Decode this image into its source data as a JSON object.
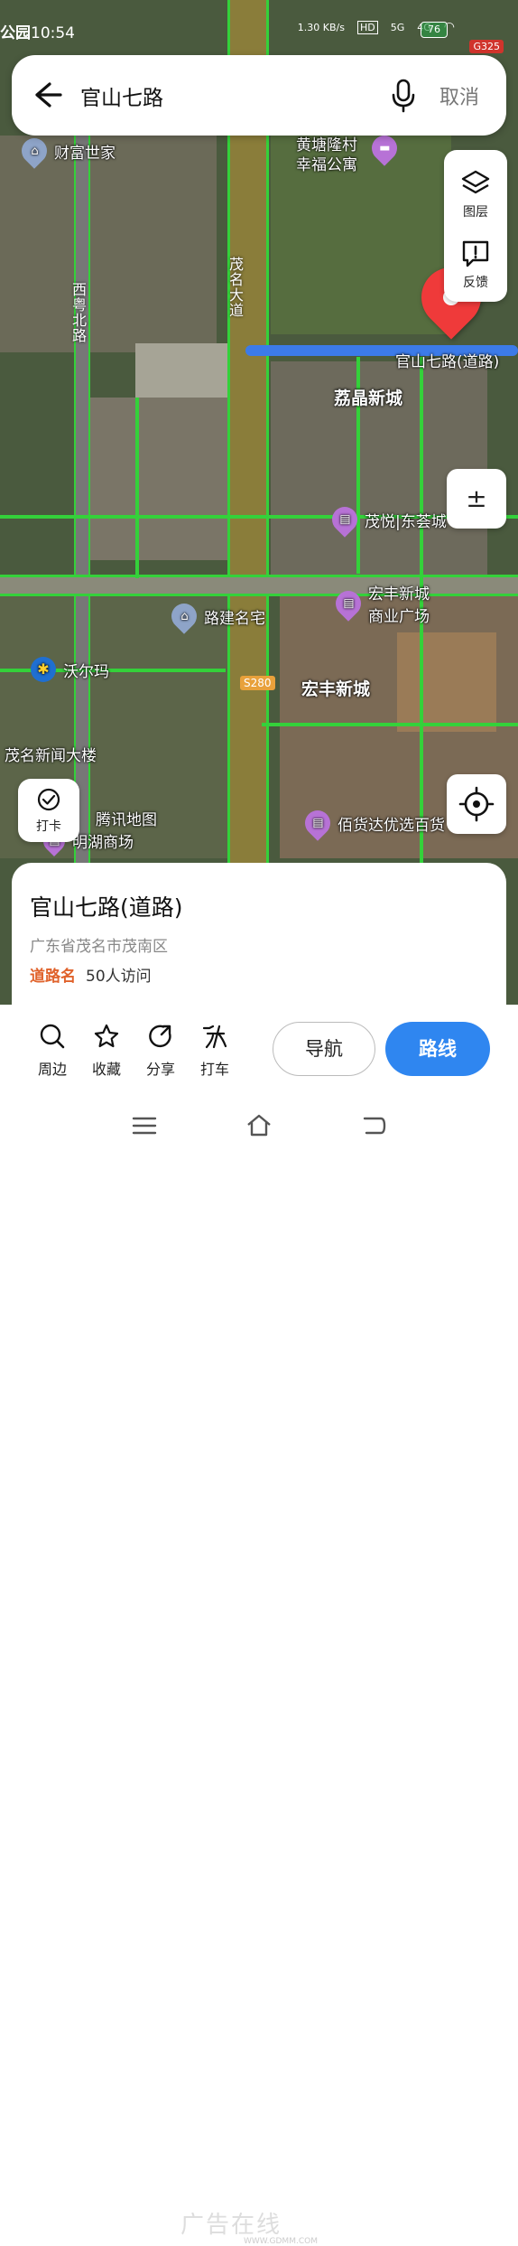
{
  "status_bar": {
    "left_text": "公园",
    "time": "10:54",
    "speed": "1.30 KB/s",
    "hd": "HD",
    "net1": "5G",
    "net2": "4G",
    "battery": "76",
    "road_badge": "G325"
  },
  "search": {
    "query": "官山七路",
    "cancel_label": "取消"
  },
  "side_panel": {
    "layers_label": "图层",
    "feedback_label": "反馈"
  },
  "map": {
    "pois": {
      "caifu": "财富世家",
      "huangtang": "黄塘隆村",
      "huangtang2": "幸福公寓",
      "xiyue_road": "西粤北路",
      "maoming_ave": "茂名大道",
      "guanshan_road": "官山七路(道路)",
      "lijing": "荔晶新城",
      "maoyue": "茂悦|东荟城",
      "hongfeng_plaza_1": "宏丰新城",
      "hongfeng_plaza_2": "商业广场",
      "lujian": "路建名宅",
      "walmart": "沃尔玛",
      "hongfeng_city": "宏丰新城",
      "maoming_news": "茂名新闻大楼",
      "tencent_map": "腾讯地图",
      "minghu": "明湖商场",
      "baihuoda": "佰货达优选百货",
      "s280": "S280"
    }
  },
  "controls": {
    "zoom_label": "±",
    "checkin_label": "打卡"
  },
  "card": {
    "title": "官山七路(道路)",
    "address": "广东省茂名市茂南区",
    "tag": "道路名",
    "visits": "50人访问"
  },
  "actions": {
    "nearby": "周边",
    "favorite": "收藏",
    "share": "分享",
    "taxi": "打车",
    "navigate": "导航",
    "route": "路线"
  },
  "watermark": {
    "main": "广告在线",
    "sub": "WWW.GDMM.COM"
  },
  "colors": {
    "road_green": "#34d13a",
    "highlight_blue": "#3c7be8",
    "pin_red": "#ef3a3a",
    "primary_blue": "#2f86f0",
    "tag_orange": "#e0622b"
  }
}
